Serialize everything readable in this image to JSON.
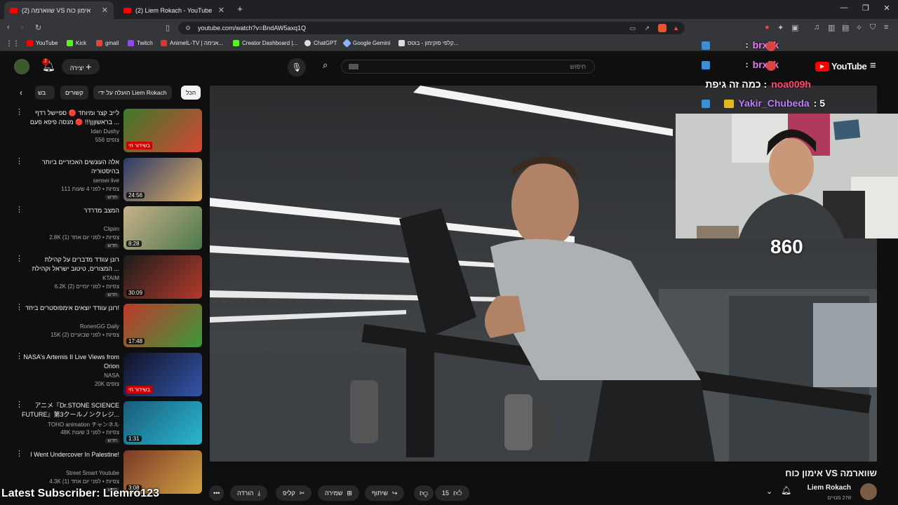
{
  "browser": {
    "tabs": [
      {
        "title": "(2) שווארמה VS אימון כוח",
        "active": true
      },
      {
        "title": "(2) Liem Rokach - YouTube",
        "active": false
      }
    ],
    "url": "youtube.com/watch?v=BndAW5axq1Q",
    "bookmarks": [
      "YouTube",
      "Kick",
      "gmail",
      "Twitch",
      "AnimeIL-TV | אנימה...",
      "Creator Dashboard |...",
      "ChatGPT",
      "Google Gemini",
      "קלפי פוקימון - בוטס..."
    ]
  },
  "youtube": {
    "logo": "YouTube",
    "search_placeholder": "חיפוש",
    "create_label": "יצירה",
    "notif_count": "2",
    "chips": [
      "הכל",
      "הועלה על ידי Liem Rokach",
      "קשורים",
      "בש"
    ]
  },
  "recommendations": [
    {
      "title": "לייב קצר ומיוחד 🔴 ספיישל רדף בראשוןןן!!! 🔴 מנסה פיפא פעם ...",
      "channel": "Idan Dushy",
      "meta": "556 צופים",
      "tag": "בשידור חי",
      "live": true,
      "badge": ""
    },
    {
      "title": "אלה העונשים האכזריים ביותר בהיסטוריה",
      "channel": "sensei live",
      "meta": "111 צפיות • לפני 4 שעות",
      "tag": "24:56",
      "live": false,
      "badge": "חדש"
    },
    {
      "title": "המצב מדרדר",
      "channel": "Clipim",
      "meta": "2.8K צפיות • לפני יום אחד (1)",
      "tag": "8:28",
      "live": false,
      "badge": "חדש"
    },
    {
      "title": "רונן עוודד מדברים על קהילת המצורים, טיטוב ישראל וקהילת ...",
      "channel": "KTAIM",
      "meta": "6.2K צפיות • לפני יומיים (2)",
      "tag": "30:09",
      "live": false,
      "badge": "חדש"
    },
    {
      "title": "רונן עוודד יוצאים אימפוסטרים ביחד!",
      "channel": "RonenGG Daily",
      "meta": "15K צפיות • לפני שבועיים (2)",
      "tag": "17:48",
      "live": false,
      "badge": ""
    },
    {
      "title": "NASA's Artemis II Live Views from Orion",
      "channel": "NASA",
      "meta": "20K צופים",
      "tag": "בשידור חי",
      "live": true,
      "badge": ""
    },
    {
      "title": "アニメ『Dr.STONE SCIENCE FUTURE』第3クールノンクレジ...",
      "channel": "TOHO animation チャンネル",
      "meta": "48K צפיות • לפני 3 שעות",
      "tag": "1:31",
      "live": false,
      "badge": "חדש"
    },
    {
      "title": "I Went Undercover In Palestine!",
      "channel": "Street Smart Youtube",
      "meta": "4.3K צפיות • לפני יום אחד (1)",
      "tag": "3:08",
      "live": false,
      "badge": "חדש"
    }
  ],
  "video": {
    "title": "שווארמה VS אימון כוח",
    "channel": "Liem Rokach",
    "subscribers": "278 מנויים",
    "likes": "15",
    "share_label": "שיתוף",
    "save_label": "שמירה",
    "clip_label": "קליפ",
    "download_label": "הורדה"
  },
  "stream_overlay": {
    "chat": [
      {
        "user": "brxkk",
        "msg": ":",
        "color": "#e77cf2"
      },
      {
        "user": "brxkk",
        "msg": ":",
        "color": "#e77cf2"
      },
      {
        "user": "noa009h",
        "msg": ": כמה זה גיפת",
        "color": "#ff4b6e"
      },
      {
        "user": "Yakir_Chubeda",
        "msg": ": 5",
        "color": "#c17aff"
      }
    ],
    "counter": "860",
    "latest_sub": "Latest Subscriber: Liemro123"
  },
  "colors": {
    "yt_red": "#ff0000",
    "bg": "#0f0f0f",
    "chip": "#272727"
  }
}
